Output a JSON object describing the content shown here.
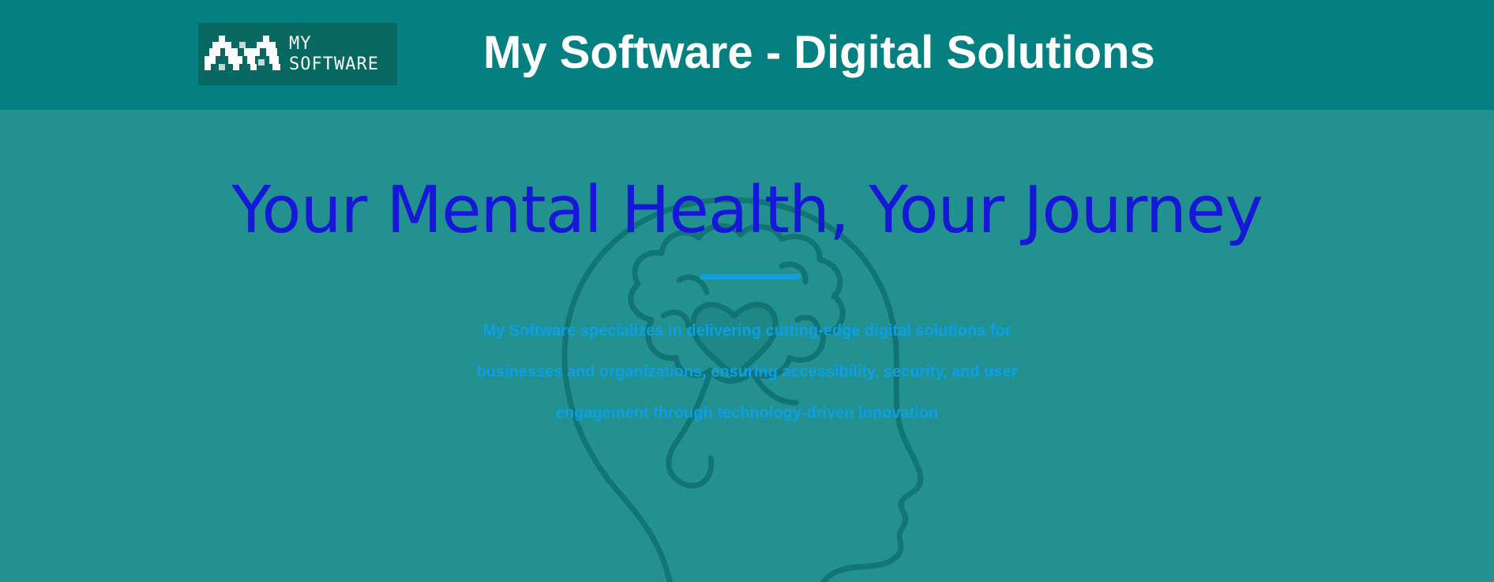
{
  "header": {
    "logo": {
      "line1": "MY",
      "line2": "SOFTWARE"
    },
    "title": "My Software - Digital Solutions"
  },
  "hero": {
    "heading": "Your Mental Health, Your Journey",
    "description": "My Software specializes in delivering cutting-edge digital solutions for businesses and organizations, ensuring accessibility, security, and user engagement through technology-driven innovation",
    "illustration_icon": "head-brain-heart-icon"
  },
  "colors": {
    "header_bg": "#058080",
    "hero_bg": "#23918f",
    "heading": "#1717d8",
    "accent": "#0d9fe6",
    "logo_bg": "#066860"
  }
}
